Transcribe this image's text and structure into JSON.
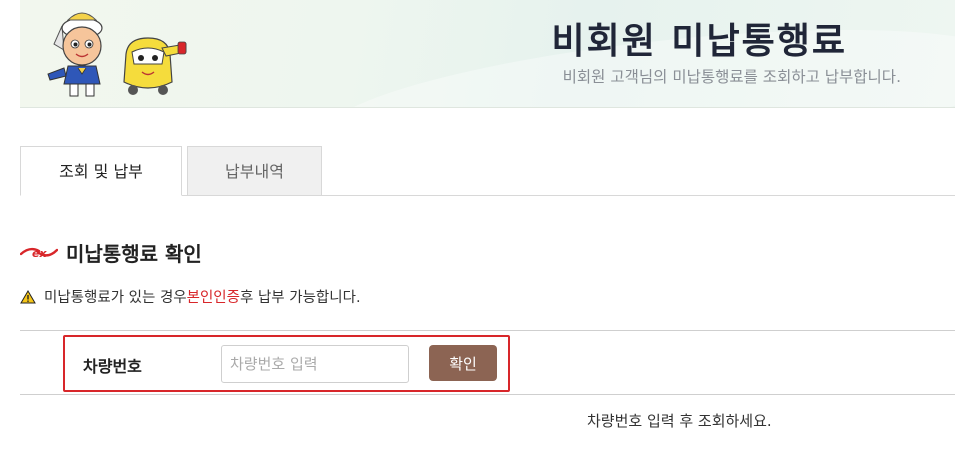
{
  "header": {
    "title": "비회원 미납통행료",
    "subtitle": "비회원 고객님의 미납통행료를 조회하고 납부합니다."
  },
  "tabs": [
    {
      "label": "조회 및 납부",
      "active": true
    },
    {
      "label": "납부내역",
      "active": false
    }
  ],
  "section": {
    "logo_text": "ex",
    "title": "미납통행료 확인"
  },
  "notice": {
    "prefix": "미납통행료가 있는 경우 ",
    "highlight": "본인인증",
    "suffix": " 후 납부 가능합니다.",
    "highlight_color": "#d8262a",
    "icon": "warning-icon"
  },
  "form": {
    "plate_label": "차량번호",
    "plate_placeholder": "차량번호 입력",
    "plate_value": "",
    "confirm_label": "확인",
    "button_color": "#8c6453"
  },
  "hint": "차량번호 입력 후 조회하세요."
}
